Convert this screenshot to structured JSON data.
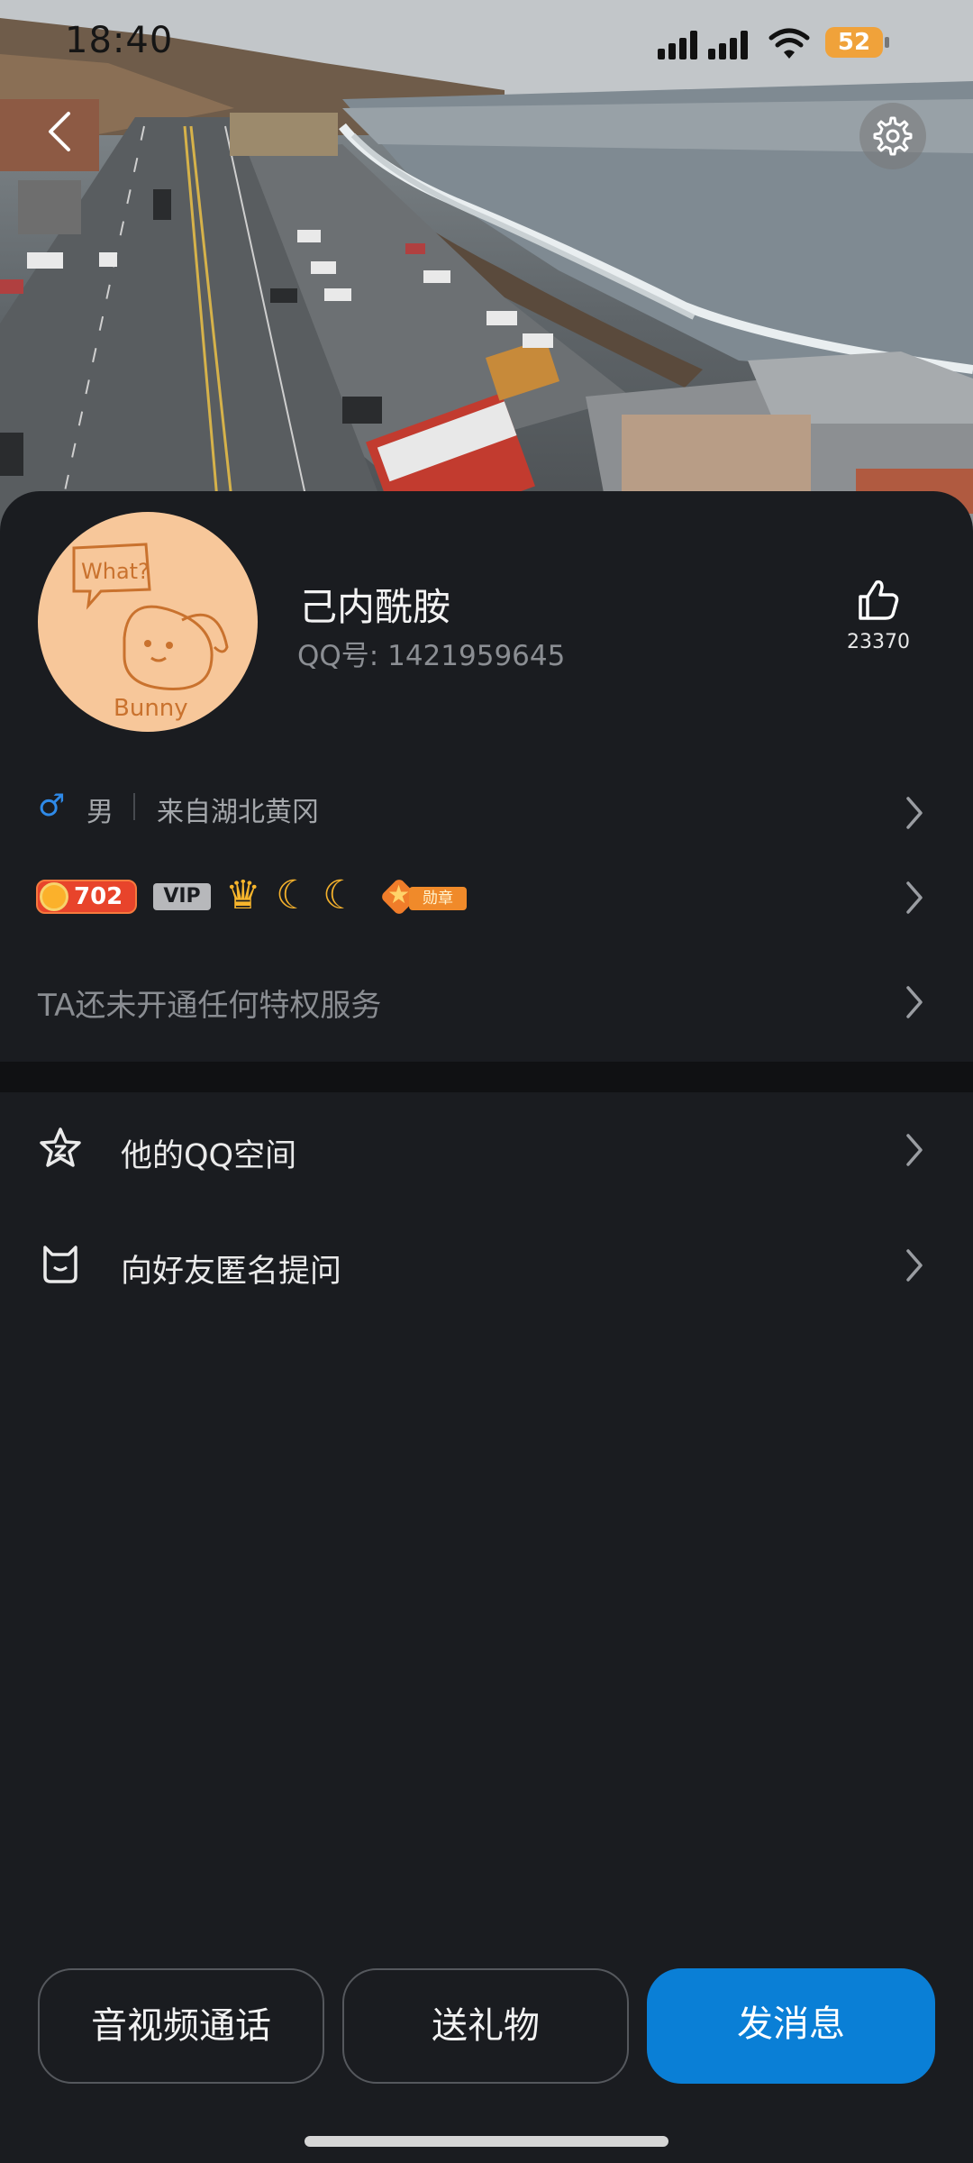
{
  "status_bar": {
    "time": "18:40",
    "battery": "52"
  },
  "profile": {
    "nickname": "己内酰胺",
    "qq_label": "QQ号: 1421959645",
    "like_count": "23370",
    "gender": "男",
    "location": "来自湖北黄冈",
    "level": "702",
    "vip_label": "VIP",
    "medal_label": "勋章",
    "privilege_text": "TA还未开通任何特权服务",
    "avatar_text_1": "What?",
    "avatar_text_2": "Bunny"
  },
  "menu": [
    {
      "label": "他的QQ空间",
      "icon": "star-icon"
    },
    {
      "label": "向好友匿名提问",
      "icon": "cat-icon"
    }
  ],
  "actions": {
    "call": "音视频通话",
    "gift": "送礼物",
    "message": "发消息"
  },
  "colors": {
    "background": "#1a1c20",
    "primary_button": "#0a7fd6",
    "gender_blue": "#2f8ae8",
    "battery": "#f0a23a"
  }
}
